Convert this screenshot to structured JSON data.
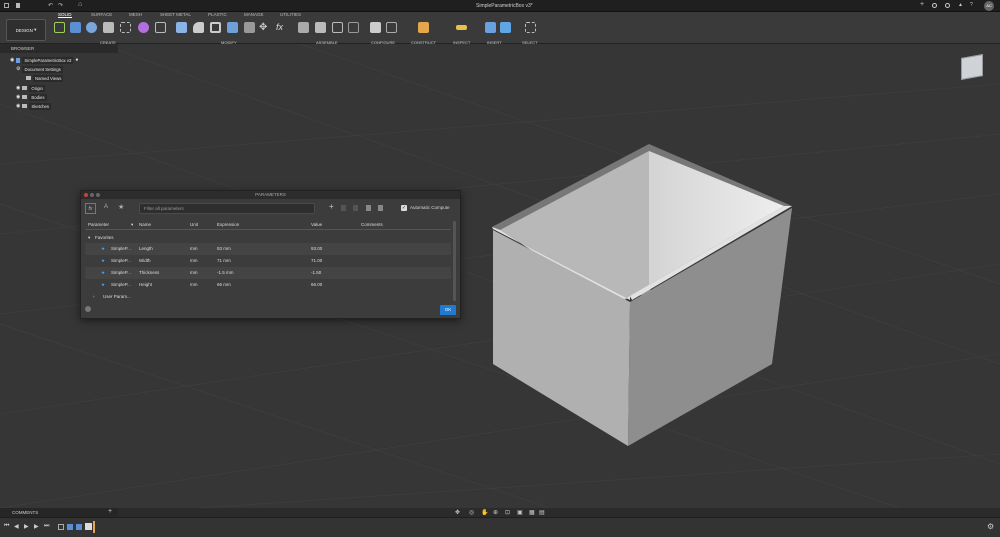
{
  "window": {
    "title": "SimpleParametricBox v3*",
    "user": "AC"
  },
  "toolbar": {
    "workspace": "DESIGN",
    "tabs": [
      "SOLID",
      "SURFACE",
      "MESH",
      "SHEET METAL",
      "PLASTIC",
      "MANAGE",
      "UTILITIES"
    ],
    "groups": [
      "CREATE",
      "MODIFY",
      "ASSEMBLE",
      "CONFIGURE",
      "CONSTRUCT",
      "INSPECT",
      "INSERT",
      "SELECT"
    ]
  },
  "browser": {
    "header": "BROWSER",
    "root": "SimpleParametricBox v3",
    "items": [
      "Document Settings",
      "Named Views",
      "Origin",
      "Bodies",
      "Sketches"
    ]
  },
  "parameters": {
    "title": "PARAMETERS",
    "filter_placeholder": "Filter all parameters",
    "auto_compute": "Automatic Compute",
    "columns": [
      "Parameter",
      "Name",
      "Unit",
      "Expression",
      "Value",
      "Comments"
    ],
    "favorites_label": "Favorites",
    "rows": [
      {
        "param": "SimpleP...",
        "name": "Length",
        "unit": "mm",
        "expr": "93 mm",
        "value": "93.00"
      },
      {
        "param": "SimpleP...",
        "name": "Width",
        "unit": "mm",
        "expr": "71 mm",
        "value": "71.00"
      },
      {
        "param": "SimpleP...",
        "name": "Thickness",
        "unit": "mm",
        "expr": "-1.5 mm",
        "value": "-1.50"
      },
      {
        "param": "SimpleP...",
        "name": "Height",
        "unit": "mm",
        "expr": "66 mm",
        "value": "66.00"
      }
    ],
    "user_params": "User Param...",
    "ok": "OK"
  },
  "comments": {
    "label": "COMMENTS"
  },
  "colors": {
    "accent": "#1f7bd1",
    "star": "#4aa3ff"
  }
}
